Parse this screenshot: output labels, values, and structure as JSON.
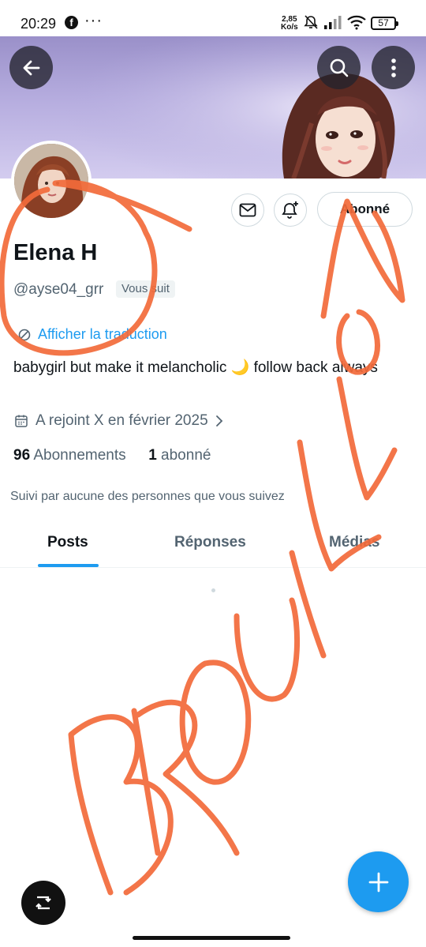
{
  "status_bar": {
    "time": "20:29",
    "app_icon": "facebook-icon",
    "more": "···",
    "speed_value": "2,85",
    "speed_unit": "Ko/s",
    "icons": [
      "mute-icon",
      "signal-icon",
      "wifi-icon"
    ],
    "battery": "57"
  },
  "header": {
    "icons": [
      "back-arrow-icon",
      "search-icon",
      "more-vertical-icon"
    ]
  },
  "profile": {
    "name": "Elena H",
    "handle": "@ayse04_grr",
    "follows_you_badge": "Vous suit",
    "follow_button_label": "Abonné",
    "translate_link": "Afficher la traduction",
    "bio": "babygirl but make it melancholic 🌙 follow back always",
    "joined": "A rejoint X en février 2025",
    "following_count": "96",
    "following_label": "Abonnements",
    "followers_count": "1",
    "followers_label": "abonné",
    "followed_by": "Suivi par aucune des personnes que vous suivez"
  },
  "tabs": [
    {
      "label": "Posts",
      "active": true
    },
    {
      "label": "Réponses",
      "active": false
    },
    {
      "label": "Médias",
      "active": false
    }
  ],
  "overlay_text": "BROUILLON",
  "colors": {
    "accent": "#1d9bf0",
    "annotation": "#f26a3a",
    "banner": "#b6addf"
  }
}
